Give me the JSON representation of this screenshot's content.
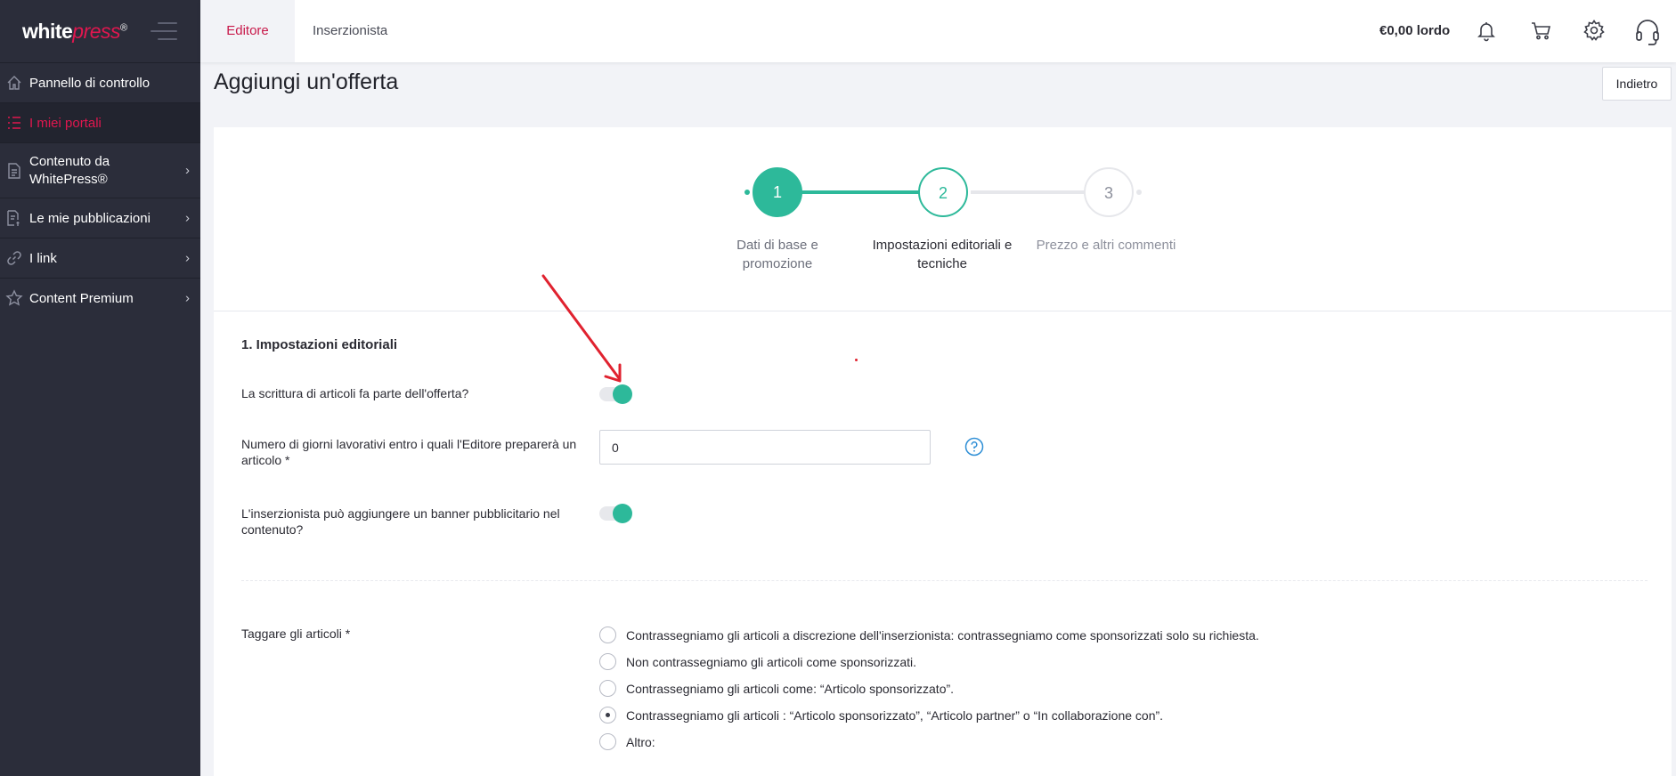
{
  "brand": {
    "name_white": "white",
    "name_press": "press",
    "mark": "®"
  },
  "sidebar": {
    "items": [
      {
        "label": "Pannello di controllo",
        "icon": "home-icon"
      },
      {
        "label": "I miei portali",
        "icon": "list-icon"
      },
      {
        "label": "Contenuto da WhitePress®",
        "icon": "document-icon"
      },
      {
        "label": "Le mie pubblicazioni",
        "icon": "publications-icon"
      },
      {
        "label": "I link",
        "icon": "link-icon"
      },
      {
        "label": "Content Premium",
        "icon": "star-icon"
      }
    ]
  },
  "topbar": {
    "tabs": [
      {
        "label": "Editore"
      },
      {
        "label": "Inserzionista"
      }
    ],
    "balance": "€0,00 lordo"
  },
  "page": {
    "title": "Aggiungi un'offerta",
    "back_label": "Indietro"
  },
  "stepper": {
    "steps": [
      {
        "number": "1",
        "label": "Dati di base e promozione",
        "state": "completed"
      },
      {
        "number": "2",
        "label": "Impostazioni editoriali e tecniche",
        "state": "current"
      },
      {
        "number": "3",
        "label": "Prezzo e altri commenti",
        "state": "upcoming"
      }
    ]
  },
  "form": {
    "section_title": "1. Impostazioni editoriali",
    "article_writing": {
      "label": "La scrittura di articoli fa parte dell'offerta?",
      "enabled": true
    },
    "days": {
      "label": "Numero di giorni lavorativi entro i quali l'Editore preparerà un articolo *",
      "value": "0"
    },
    "banner": {
      "label": "L'inserzionista può aggiungere un banner pubblicitario nel contenuto?",
      "enabled": true
    },
    "tagging": {
      "label": "Taggare gli articoli *",
      "options": [
        "Contrassegniamo gli articoli a discrezione dell'inserzionista: contrassegniamo come sponsorizzati solo su richiesta.",
        "Non contrassegniamo gli articoli come sponsorizzati.",
        "Contrassegniamo gli articoli come: “Articolo sponsorizzato”.",
        "Contrassegniamo gli articoli : “Articolo sponsorizzato”, “Articolo partner” o “In collaborazione con”.",
        "Altro:"
      ],
      "selected_index": 3
    }
  },
  "colors": {
    "accent": "#2db99a",
    "brand": "#e0174f",
    "sidebar": "#2b2d3a"
  }
}
